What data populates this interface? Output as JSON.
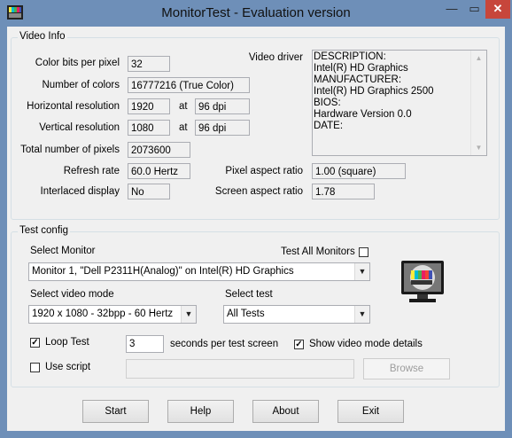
{
  "window": {
    "title": "MonitorTest - Evaluation version",
    "minimize_glyph": "—",
    "maximize_glyph": "▭",
    "close_glyph": "✕"
  },
  "video_info": {
    "group_title": "Video Info",
    "color_bits_label": "Color bits per pixel",
    "color_bits_value": "32",
    "num_colors_label": "Number of colors",
    "num_colors_value": "16777216 (True Color)",
    "hres_label": "Horizontal resolution",
    "hres_value": "1920",
    "hres_at": "at",
    "hres_dpi": "96 dpi",
    "vres_label": "Vertical resolution",
    "vres_value": "1080",
    "vres_at": "at",
    "vres_dpi": "96 dpi",
    "total_pixels_label": "Total number of pixels",
    "total_pixels_value": "2073600",
    "refresh_label": "Refresh rate",
    "refresh_value": "60.0 Hertz",
    "interlaced_label": "Interlaced display",
    "interlaced_value": "No",
    "video_driver_label": "Video driver",
    "driver_lines": "DESCRIPTION:\nIntel(R) HD Graphics\nMANUFACTURER:\nIntel(R) HD Graphics 2500\nBIOS:\nHardware Version 0.0\nDATE:",
    "pixel_aspect_label": "Pixel aspect ratio",
    "pixel_aspect_value": "1.00 (square)",
    "screen_aspect_label": "Screen aspect ratio",
    "screen_aspect_value": "1.78"
  },
  "test_config": {
    "group_title": "Test config",
    "select_monitor_label": "Select Monitor",
    "test_all_label": "Test All Monitors",
    "test_all_checked": false,
    "monitor_value": "Monitor 1, \"Dell P2311H(Analog)\" on Intel(R) HD Graphics",
    "video_mode_label": "Select video mode",
    "video_mode_value": "1920 x 1080 - 32bpp - 60 Hertz",
    "select_test_label": "Select test",
    "select_test_value": "All Tests",
    "loop_test_label": "Loop Test",
    "loop_test_checked": true,
    "seconds_value": "3",
    "seconds_label": "seconds per test screen",
    "show_details_label": "Show video mode details",
    "show_details_checked": true,
    "use_script_label": "Use script",
    "use_script_checked": false,
    "script_path_value": "",
    "browse_label": "Browse"
  },
  "buttons": {
    "start": "Start",
    "help": "Help",
    "about": "About",
    "exit": "Exit"
  },
  "colors": {
    "titlebar": "#6e8fb8",
    "close_button": "#c7463b",
    "client_bg": "#f0f0f0"
  },
  "icons": {
    "app": "test-pattern-icon",
    "monitor": "monitor-test-pattern-icon",
    "combo_arrow": "chevron-down-icon",
    "check": "checkmark-icon"
  }
}
